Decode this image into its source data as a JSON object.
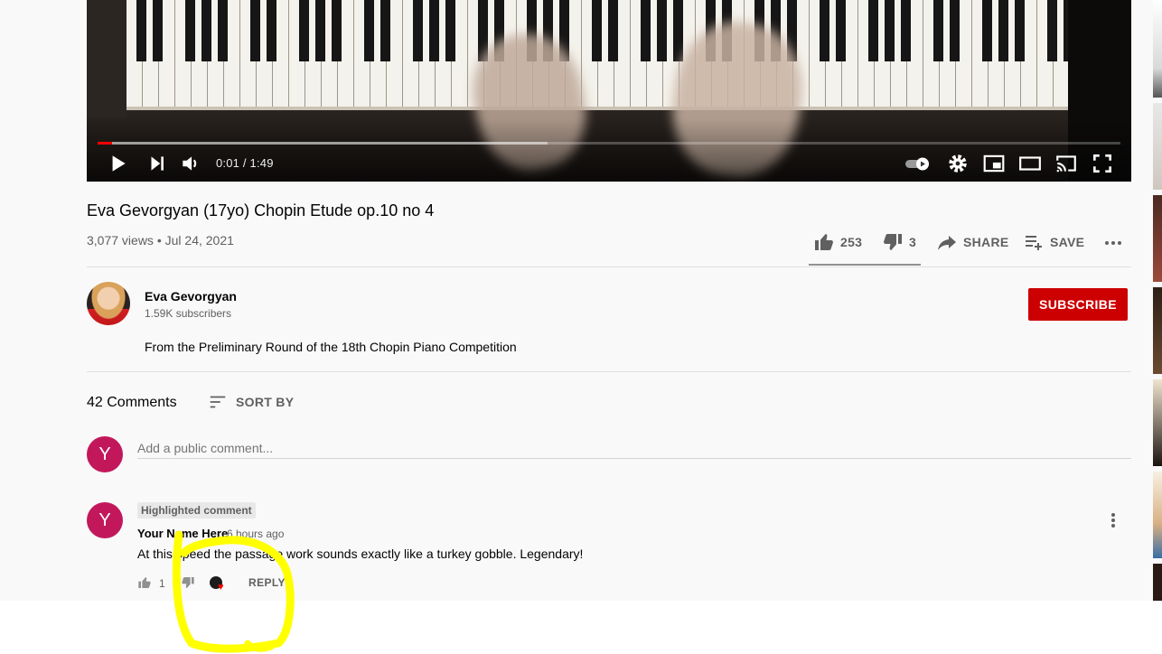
{
  "player": {
    "time_current": "0:01",
    "time_separator": " / ",
    "time_total": "1:49",
    "progress_played": 0.014,
    "progress_buffered": 0.44
  },
  "video": {
    "title": "Eva Gevorgyan (17yo) Chopin Etude op.10 no 4",
    "views": "3,077 views",
    "date_sep": " • ",
    "date": "Jul 24, 2021",
    "likes": "253",
    "dislikes": "3",
    "share_label": "SHARE",
    "save_label": "SAVE",
    "like_ratio": 0.988
  },
  "channel": {
    "name": "Eva Gevorgyan",
    "subscribers": "1.59K subscribers",
    "subscribe_label": "SUBSCRIBE",
    "description": "From the Preliminary Round of the 18th Chopin Piano Competition"
  },
  "comments": {
    "count_label": "42 Comments",
    "sort_label": "SORT BY",
    "add_placeholder": "Add a public comment...",
    "user_initial": "Y",
    "items": [
      {
        "badge": "Highlighted comment",
        "author": "Your Name Here",
        "time": "6 hours ago",
        "text": "At this speed the passage work sounds exactly like a turkey gobble. Legendary!",
        "likes": "1",
        "reply_label": "REPLY",
        "avatar_initial": "Y",
        "hearted": true
      }
    ]
  },
  "colors": {
    "accent_red": "#cc0000",
    "avatar_pink": "#c2185b",
    "annotation_yellow": "#ffff00"
  },
  "icons": [
    "play-icon",
    "next-icon",
    "volume-icon",
    "autoplay-toggle-icon",
    "settings-icon",
    "miniplayer-icon",
    "theater-icon",
    "cast-icon",
    "fullscreen-icon",
    "thumb-up-icon",
    "thumb-down-icon",
    "share-icon",
    "save-playlist-icon",
    "more-icon",
    "sort-icon",
    "heart-icon",
    "kebab-menu-icon"
  ]
}
